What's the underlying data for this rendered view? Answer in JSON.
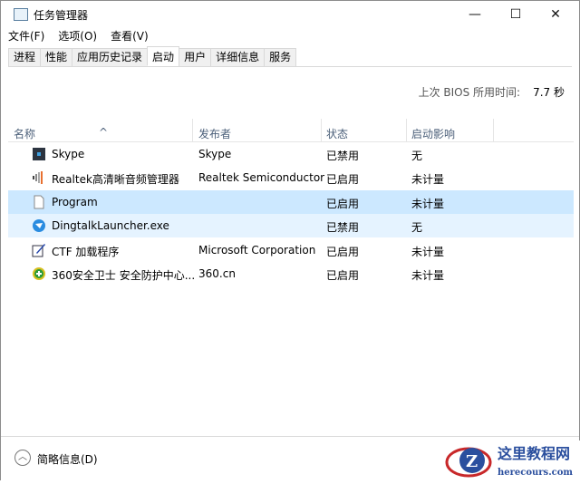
{
  "window": {
    "title": "任务管理器",
    "minimize": "—",
    "maximize": "☐",
    "close": "✕"
  },
  "menu": [
    "文件(F)",
    "选项(O)",
    "查看(V)"
  ],
  "tabs": [
    "进程",
    "性能",
    "应用历史记录",
    "启动",
    "用户",
    "详细信息",
    "服务"
  ],
  "active_tab": "启动",
  "bios": {
    "label": "上次 BIOS 所用时间:",
    "value": "7.7 秒"
  },
  "columns": [
    "名称",
    "发布者",
    "状态",
    "启动影响"
  ],
  "rows": [
    {
      "name": "Skype",
      "publisher": "Skype",
      "status": "已禁用",
      "impact": "无",
      "icon": "skype-icon"
    },
    {
      "name": "Realtek高清晰音频管理器",
      "publisher": "Realtek Semiconductor",
      "status": "已启用",
      "impact": "未计量",
      "icon": "speaker-icon"
    },
    {
      "name": "Program",
      "publisher": "",
      "status": "已启用",
      "impact": "未计量",
      "icon": "file-icon"
    },
    {
      "name": "DingtalkLauncher.exe",
      "publisher": "",
      "status": "已禁用",
      "impact": "无",
      "icon": "dingtalk-icon"
    },
    {
      "name": "CTF 加载程序",
      "publisher": "Microsoft Corporation",
      "status": "已启用",
      "impact": "未计量",
      "icon": "ctf-pen-icon"
    },
    {
      "name": "360安全卫士 安全防护中心...",
      "publisher": "360.cn",
      "status": "已启用",
      "impact": "未计量",
      "icon": "360-icon"
    }
  ],
  "footer": {
    "label": "简略信息(D)"
  },
  "watermark": {
    "title": "这里教程网",
    "url": "herecours.com"
  }
}
